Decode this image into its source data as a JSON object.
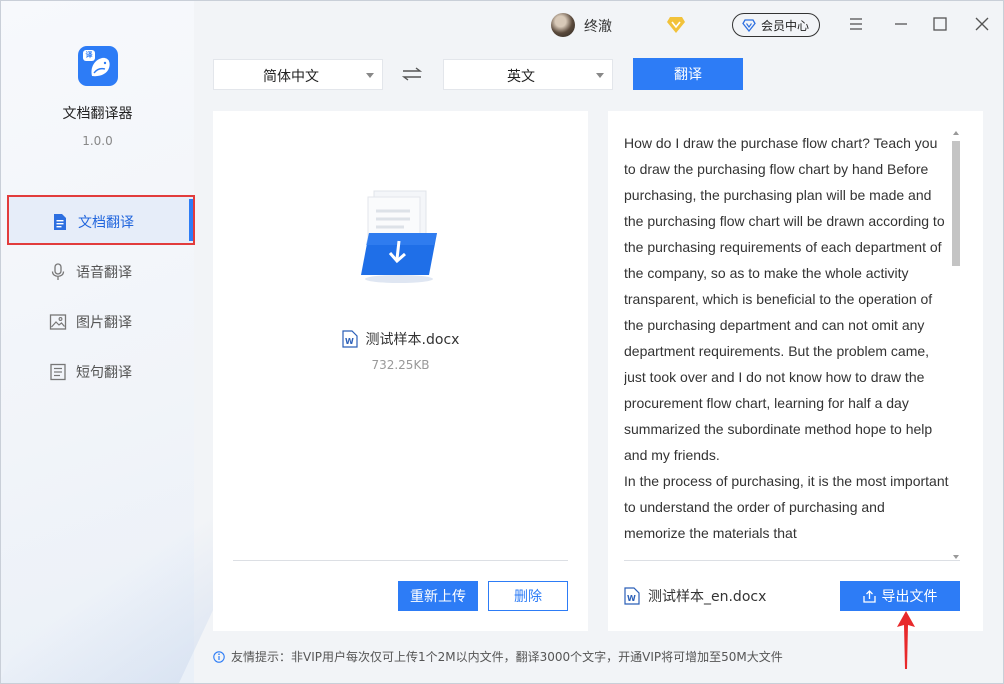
{
  "app": {
    "name": "文档翻译器",
    "version": "1.0.0"
  },
  "sidebar": {
    "items": [
      {
        "label": "文档翻译",
        "icon": "document-icon",
        "active": true
      },
      {
        "label": "语音翻译",
        "icon": "microphone-icon",
        "active": false
      },
      {
        "label": "图片翻译",
        "icon": "image-icon",
        "active": false
      },
      {
        "label": "短句翻译",
        "icon": "sentence-icon",
        "active": false
      }
    ]
  },
  "titlebar": {
    "username": "终澈",
    "member_label": "会员中心"
  },
  "toolbar": {
    "source_lang": "简体中文",
    "target_lang": "英文",
    "translate_label": "翻译"
  },
  "source": {
    "file_name": "测试样本.docx",
    "file_size": "732.25KB",
    "reupload_label": "重新上传",
    "delete_label": "删除"
  },
  "result": {
    "paragraphs": [
      "How do I draw the purchase flow chart? Teach you to draw the purchasing flow chart by hand Before purchasing, the purchasing plan will be made and the purchasing flow chart will be drawn according to the purchasing requirements of each department of the company, so as to make the whole activity transparent, which is beneficial to the operation of the purchasing department and can not omit any department requirements. But the problem came, just took over and I do not know how to draw the procurement flow chart, learning for half a day summarized the subordinate method hope to help and my friends.",
      "In the process of purchasing, it is the most important to understand the order of purchasing and memorize the materials that"
    ],
    "file_name": "测试样本_en.docx",
    "export_label": "导出文件"
  },
  "tip": "友情提示：非VIP用户每次仅可上传1个2M以内文件，翻译3000个文字，开通VIP将可增加至50M大文件",
  "colors": {
    "accent": "#2d7cf6",
    "highlight_border": "#e23c3c"
  }
}
